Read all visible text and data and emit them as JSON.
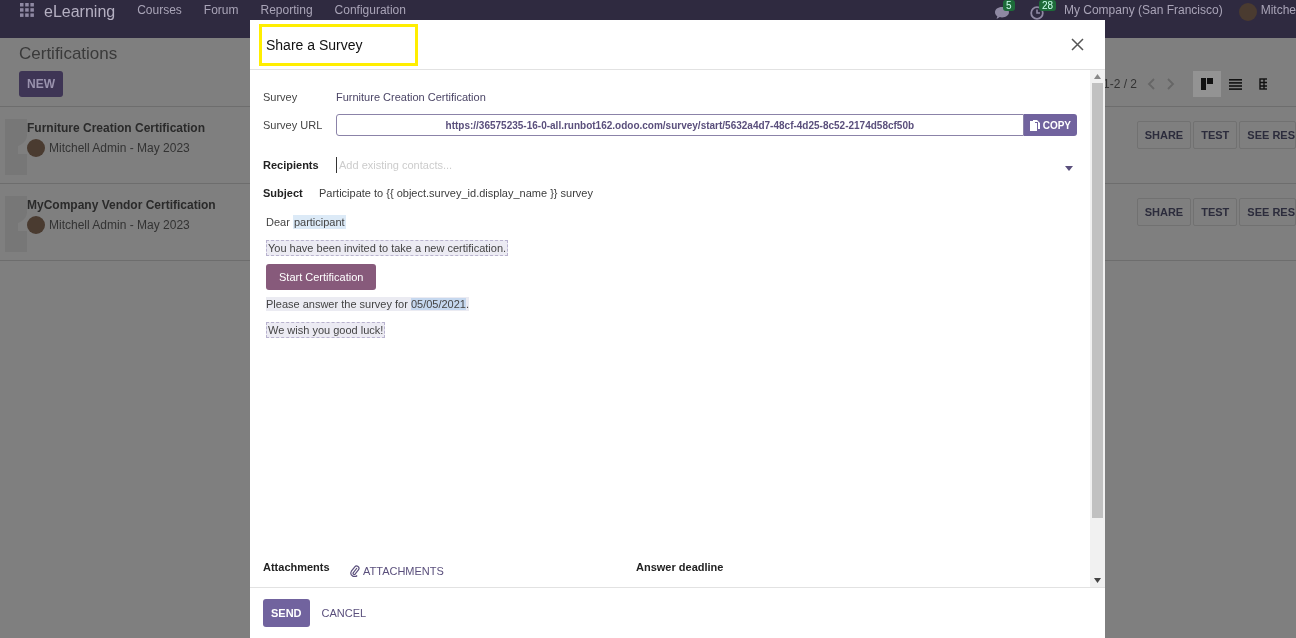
{
  "navbar": {
    "app_name": "eLearning",
    "menu": [
      "Courses",
      "Forum",
      "Reporting",
      "Configuration"
    ],
    "messages_badge": "5",
    "activities_badge": "28",
    "company": "My Company (San Francisco)",
    "user": "Mitche"
  },
  "page": {
    "title": "Certifications",
    "new_button": "NEW",
    "pager": "1-2 / 2",
    "views": [
      {
        "kind": "kanban",
        "selected": true
      },
      {
        "kind": "list",
        "selected": false
      },
      {
        "kind": "grid",
        "selected": false
      }
    ],
    "cards": [
      {
        "title": "Furniture Creation Certification",
        "meta": "Mitchell Admin - May 2023",
        "buttons": [
          "SHARE",
          "TEST",
          "SEE RES"
        ]
      },
      {
        "title": "MyCompany Vendor Certification",
        "meta": "Mitchell Admin - May 2023",
        "buttons": [
          "SHARE",
          "TEST",
          "SEE RES"
        ]
      }
    ]
  },
  "dialog": {
    "title": "Share a Survey",
    "title_highlighted": true,
    "survey_label": "Survey",
    "survey_value": "Furniture Creation Certification",
    "url_label": "Survey URL",
    "url_value": "https://36575235-16-0-all.runbot162.odoo.com/survey/start/5632a4d7-48cf-4d25-8c52-2174d58cf50b",
    "copy_button": "COPY",
    "recipients_label": "Recipients",
    "recipients_placeholder": "Add existing contacts...",
    "subject_label": "Subject",
    "subject_value": "Participate to {{ object.survey_id.display_name }} survey",
    "message": {
      "greeting": "Dear",
      "recipient": "participant",
      "invite": "You have been invited to take a new certification.",
      "button": "Start Certification",
      "deadline_text": "Please answer the survey for",
      "deadline_date": "05/05/2021",
      "deadline_end": ".",
      "closing": "We wish you good luck!"
    },
    "attachments_label": "Attachments",
    "attachments_button": "ATTACHMENTS",
    "deadline_label": "Answer deadline",
    "send_button": "SEND",
    "cancel_button": "CANCEL"
  }
}
